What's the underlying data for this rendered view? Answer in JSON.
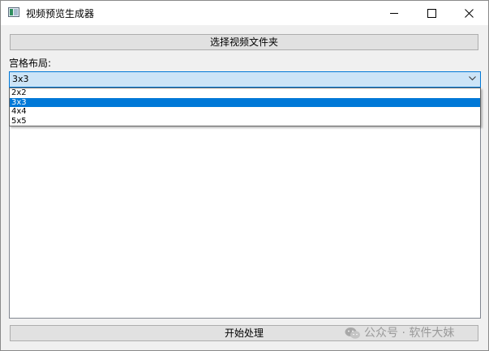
{
  "window": {
    "title": "视频预览生成器",
    "icon": "app-window-icon",
    "controls": [
      "minimize-icon",
      "maximize-icon",
      "close-icon"
    ]
  },
  "toolbar": {
    "select_folder_label": "选择视频文件夹"
  },
  "grid": {
    "label": "宫格布局:",
    "selected": "3x3",
    "options": [
      "2x2",
      "3x3",
      "4x4",
      "5x5"
    ],
    "highlighted_option": "3x3"
  },
  "footer": {
    "start_label": "开始处理"
  },
  "watermark": {
    "text": "公众号 · 软件大妹",
    "icon": "wechat-icon"
  },
  "colors": {
    "accent": "#0078d7",
    "combo_bg": "#cce4f7",
    "button_bg": "#e1e1e1"
  }
}
